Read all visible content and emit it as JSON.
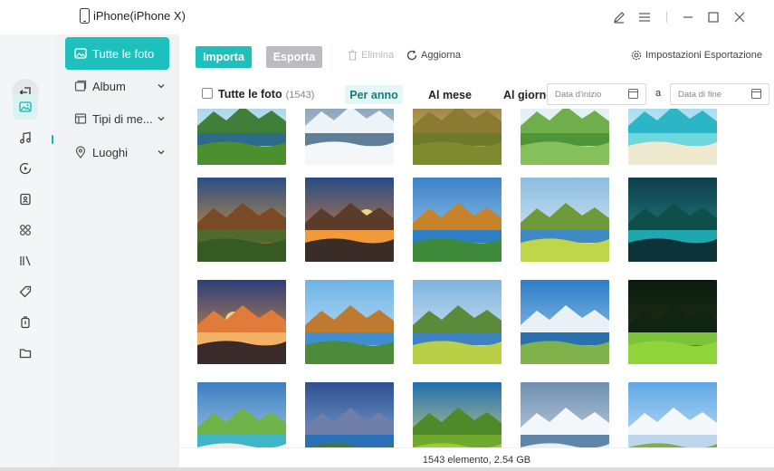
{
  "device": {
    "name": "iPhone(iPhone X)"
  },
  "sidebar": {
    "categories": [
      {
        "label": "Tutte le foto",
        "icon": "photo-icon",
        "active": true
      },
      {
        "label": "Album",
        "icon": "album-icon",
        "expandable": true
      },
      {
        "label": "Tipi di me...",
        "icon": "media-types-icon",
        "expandable": true
      },
      {
        "label": "Luoghi",
        "icon": "location-icon",
        "expandable": true
      }
    ]
  },
  "rail": {
    "items": [
      "back-icon",
      "photos-icon",
      "music-icon",
      "video-icon",
      "contacts-icon",
      "apps-icon",
      "books-icon",
      "tag-icon",
      "backup-icon",
      "folder-icon"
    ]
  },
  "toolbar": {
    "import_label": "Importa",
    "export_label": "Esporta",
    "delete_label": "Elimina",
    "refresh_label": "Aggiorna",
    "export_settings_label": "Impostazioni Esportazione"
  },
  "filter": {
    "all_label": "Tutte le foto",
    "all_count": "(1543)",
    "by_year": "Per anno",
    "by_month": "Al mese",
    "by_day": "Al giorno",
    "start_date_placeholder": "Data d'inizio",
    "separator": "a",
    "end_date_placeholder": "Data di fine"
  },
  "status": {
    "text": "1543 elemento, 2.54 GB"
  },
  "colors": {
    "accent": "#1ec0bd",
    "disabled": "#b9bcc1"
  },
  "photos": [
    {
      "scene": "river-forest"
    },
    {
      "scene": "snow-river"
    },
    {
      "scene": "golden-field"
    },
    {
      "scene": "green-hills"
    },
    {
      "scene": "tropical-beach"
    },
    {
      "scene": "sunset-valley"
    },
    {
      "scene": "sunset-lake"
    },
    {
      "scene": "autumn-lake"
    },
    {
      "scene": "meadow-lake"
    },
    {
      "scene": "jungle-lake"
    },
    {
      "scene": "sunset-clouds"
    },
    {
      "scene": "autumn-reflection"
    },
    {
      "scene": "meadow-hills"
    },
    {
      "scene": "mountain-fjord"
    },
    {
      "scene": "tree-night"
    },
    {
      "scene": "coast-lagoon"
    },
    {
      "scene": "mountain-lake"
    },
    {
      "scene": "sun-flowers"
    },
    {
      "scene": "glacier-river"
    },
    {
      "scene": "sky-plain"
    }
  ]
}
